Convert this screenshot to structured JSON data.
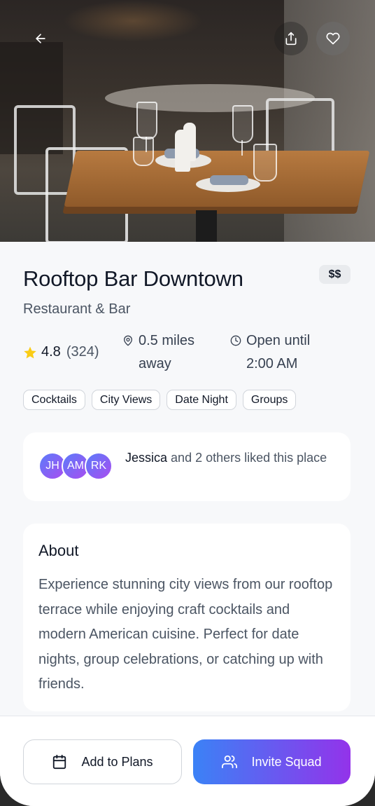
{
  "venue": {
    "name": "Rooftop Bar Downtown",
    "price": "$$",
    "category": "Restaurant & Bar",
    "rating": "4.8",
    "review_count": "(324)",
    "distance": "0.5 miles away",
    "hours": "Open until 2:00 AM"
  },
  "tags": [
    "Cocktails",
    "City Views",
    "Date Night",
    "Groups"
  ],
  "social": {
    "avatars": [
      "JH",
      "AM",
      "RK"
    ],
    "highlight_name": "Jessica",
    "text": "and 2 others liked this place"
  },
  "about": {
    "heading": "About",
    "body": "Experience stunning city views from our rooftop terrace while enjoying craft cocktails and modern American cuisine. Perfect for date nights, group celebrations, or catching up with friends."
  },
  "actions": {
    "add_to_plans": "Add to Plans",
    "invite_squad": "Invite Squad"
  },
  "icons": {
    "back": "arrow-left-icon",
    "share": "share-icon",
    "favorite": "heart-icon",
    "star": "star-icon",
    "location": "map-pin-icon",
    "clock": "clock-icon",
    "calendar": "calendar-icon",
    "users": "users-icon"
  },
  "colors": {
    "accent_start": "#3b82f6",
    "accent_end": "#9333ea",
    "star": "#facc15"
  }
}
